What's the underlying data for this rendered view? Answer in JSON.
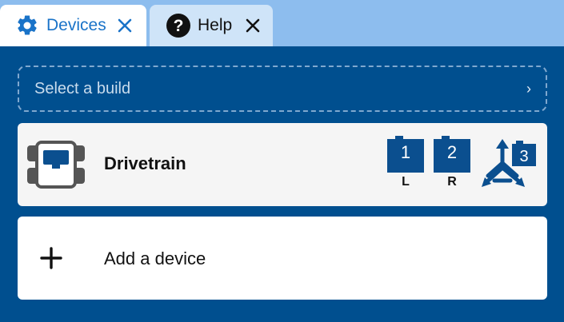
{
  "tabs": [
    {
      "label": "Devices",
      "icon": "gear-icon",
      "active": true,
      "color": "#1a73c8"
    },
    {
      "label": "Help",
      "icon": "question-icon",
      "active": false
    }
  ],
  "build_select": {
    "placeholder": "Select a build",
    "chevron": "›"
  },
  "device": {
    "name": "Drivetrain",
    "icon": "drivetrain-icon",
    "ports": [
      {
        "number": "1",
        "side": "L"
      },
      {
        "number": "2",
        "side": "R"
      }
    ],
    "gyro": {
      "number": "3",
      "icon": "gyro-icon"
    }
  },
  "add_device": {
    "label": "Add a device",
    "icon": "plus-icon"
  },
  "colors": {
    "panel": "#004f8f",
    "tabbar": "#8dbdee",
    "port": "#0b4f8f"
  }
}
